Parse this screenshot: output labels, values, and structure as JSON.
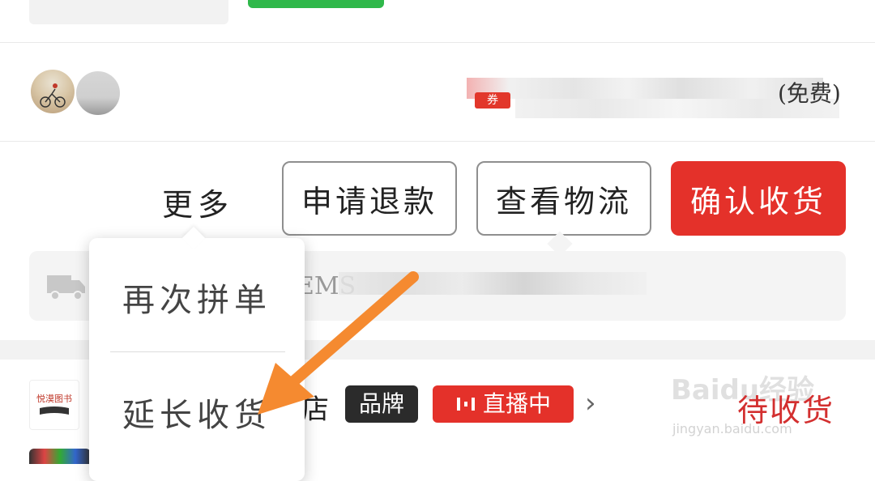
{
  "order_top": {
    "thumb": "product-thumbnail",
    "tag_color": "#2fb84a"
  },
  "group_row": {
    "avatars": [
      "user-avatar-1",
      "user-avatar-2"
    ],
    "tag_label": "券",
    "fee_suffix": "(免费)"
  },
  "actions": {
    "more_label": "更多",
    "refund_label": "申请退款",
    "logistics_label": "查看物流",
    "confirm_label": "确认收货",
    "confirm_color": "#e4312a"
  },
  "logistics": {
    "icon": "truck-icon",
    "carrier": "EMS"
  },
  "popup_menu": {
    "items": [
      "再次拼单",
      "延长收货"
    ]
  },
  "store": {
    "logo_text": "悦漠图书",
    "name_suffix": "店",
    "brand_badge": "品牌",
    "live_badge": "直播中",
    "status": "待收货",
    "status_color": "#d32f2f"
  },
  "watermark": {
    "brand": "Baidu经验",
    "url": "jingyan.baidu.com"
  }
}
